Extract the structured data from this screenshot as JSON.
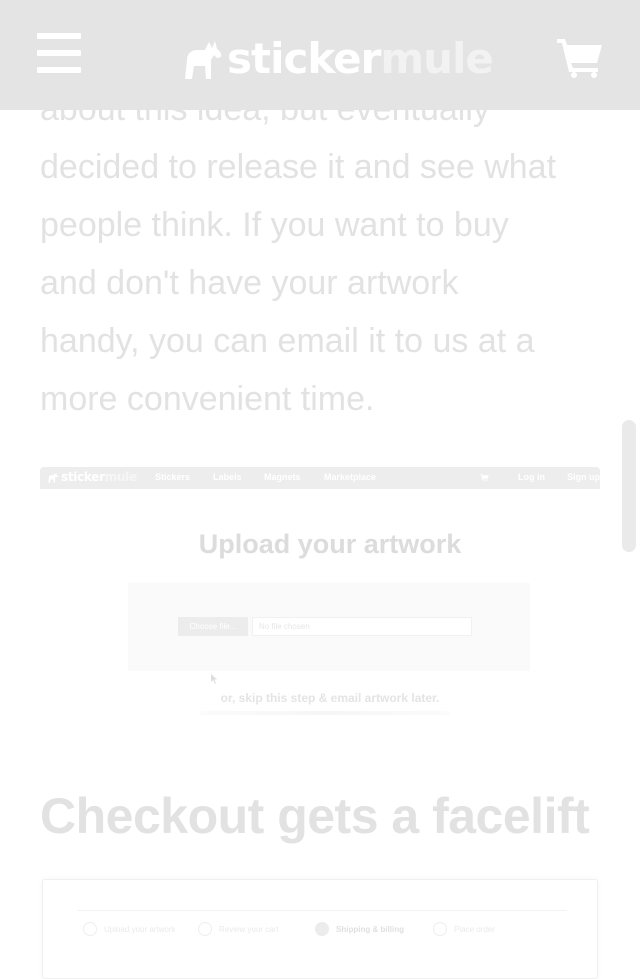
{
  "header": {
    "menu_icon": "hamburger-menu-icon",
    "logo_part1": "sticker",
    "logo_part2": "mule",
    "cart_icon": "shopping-cart-icon"
  },
  "article": {
    "paragraph_lines": [
      "about this idea, but eventually",
      "decided to release it and see what",
      "people think. If you want to buy",
      "and don't have your artwork",
      "handy, you can email it to us at a",
      "more convenient time."
    ],
    "upload_screenshot": {
      "logo_part1": "sticker",
      "logo_part2": "mule",
      "nav_links": [
        "Stickers",
        "Labels",
        "Magnets",
        "Marketplace"
      ],
      "login": "Log in",
      "signup": "Sign up",
      "title": "Upload your artwork",
      "choose_button": "Choose file...",
      "file_placeholder": "No file chosen",
      "skip_text": "or, skip this step & email artwork later."
    },
    "heading": "Checkout gets a facelift",
    "checkout_screenshot": {
      "steps": [
        "Upload your artwork",
        "Review your cart",
        "Shipping & billing",
        "Place order"
      ],
      "active_step": 3
    }
  },
  "colors": {
    "header_bg": "#e4e4e4",
    "text_faded": "#e2e2e2",
    "background": "#ffffff"
  }
}
